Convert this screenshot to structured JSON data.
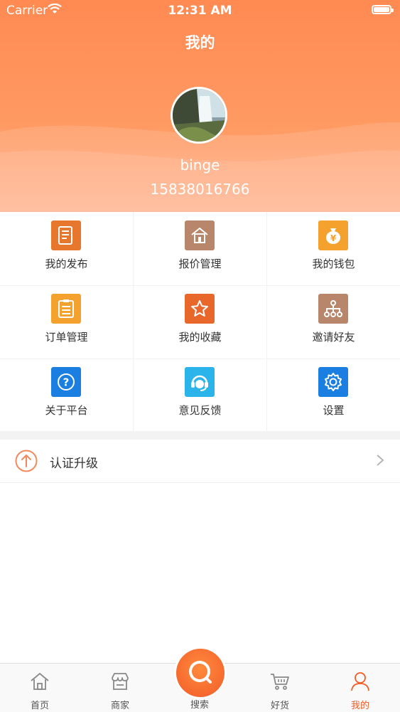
{
  "status_bar": {
    "carrier": "Carrier",
    "time": "12:31 AM"
  },
  "header": {
    "title": "我的",
    "username": "binge",
    "phone": "15838016766"
  },
  "menu": [
    {
      "label": "我的发布",
      "icon": "document-list-icon",
      "color": "#e8772e"
    },
    {
      "label": "报价管理",
      "icon": "house-icon",
      "color": "#b8866a"
    },
    {
      "label": "我的钱包",
      "icon": "money-bag-icon",
      "color": "#f4a22d"
    },
    {
      "label": "订单管理",
      "icon": "clipboard-icon",
      "color": "#f4a22d"
    },
    {
      "label": "我的收藏",
      "icon": "star-icon",
      "color": "#e8672a"
    },
    {
      "label": "邀请好友",
      "icon": "network-icon",
      "color": "#b8866a"
    },
    {
      "label": "关于平台",
      "icon": "question-icon",
      "color": "#1a7fe0"
    },
    {
      "label": "意见反馈",
      "icon": "headset-icon",
      "color": "#2ab4ea"
    },
    {
      "label": "设置",
      "icon": "gear-icon",
      "color": "#1a7fe0"
    }
  ],
  "certification": {
    "label": "认证升级",
    "icon": "arrow-up-circle-icon"
  },
  "tabbar": [
    {
      "label": "首页",
      "icon": "home-icon"
    },
    {
      "label": "商家",
      "icon": "shop-icon"
    },
    {
      "label": "搜索",
      "icon": "search-icon"
    },
    {
      "label": "好货",
      "icon": "cart-icon"
    },
    {
      "label": "我的",
      "icon": "person-icon",
      "active": true
    }
  ],
  "colors": {
    "accent": "#f25c28",
    "header_gradient_top": "#ff8a52"
  }
}
